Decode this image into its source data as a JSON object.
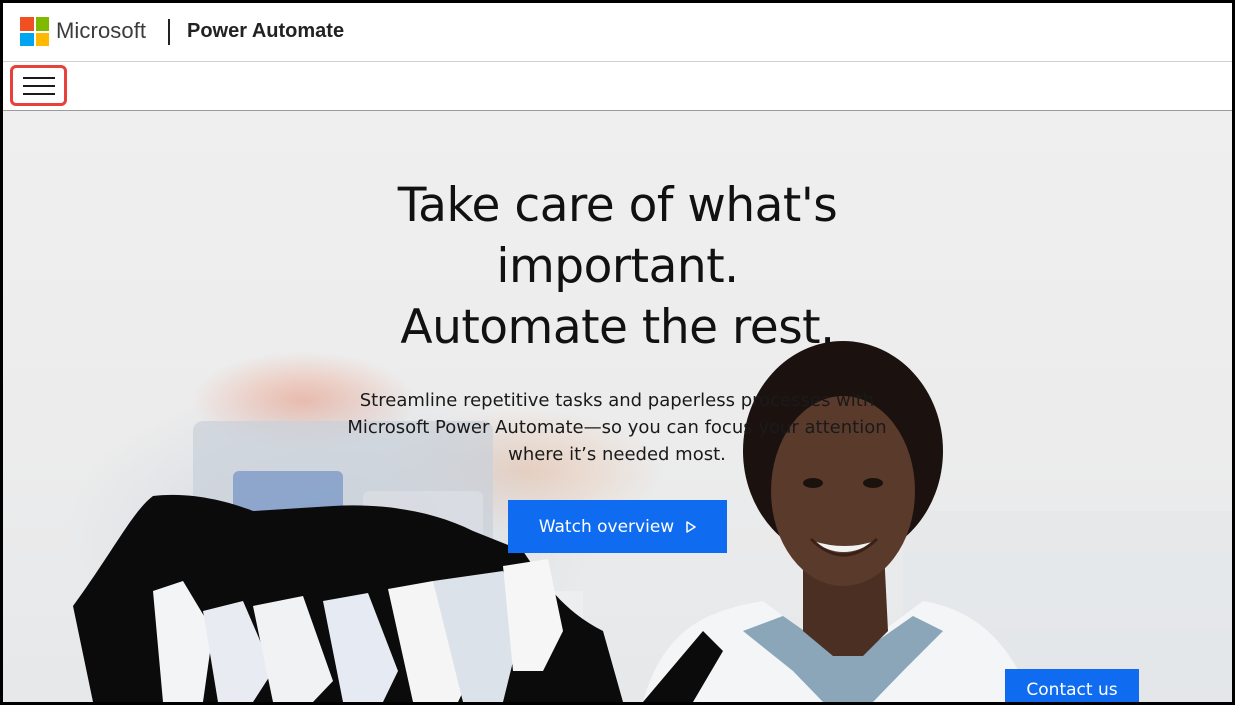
{
  "header": {
    "brand": "Microsoft",
    "product": "Power Automate",
    "logo_colors": [
      "#f25022",
      "#7fba00",
      "#00a4ef",
      "#ffb900"
    ]
  },
  "nav": {
    "menu_icon": "hamburger-menu-icon"
  },
  "hero": {
    "headline_lines": [
      "Take care of what's",
      "important.",
      "Automate the rest."
    ],
    "subhead": "Streamline repetitive tasks and paperless processes with Microsoft Power Automate—so you can focus your attention where it’s needed most.",
    "watch_label": "Watch overview",
    "watch_icon": "play-icon",
    "contact_label": "Contact us"
  },
  "colors": {
    "accent": "#0f6cf0",
    "highlight_border": "#e8403b"
  }
}
